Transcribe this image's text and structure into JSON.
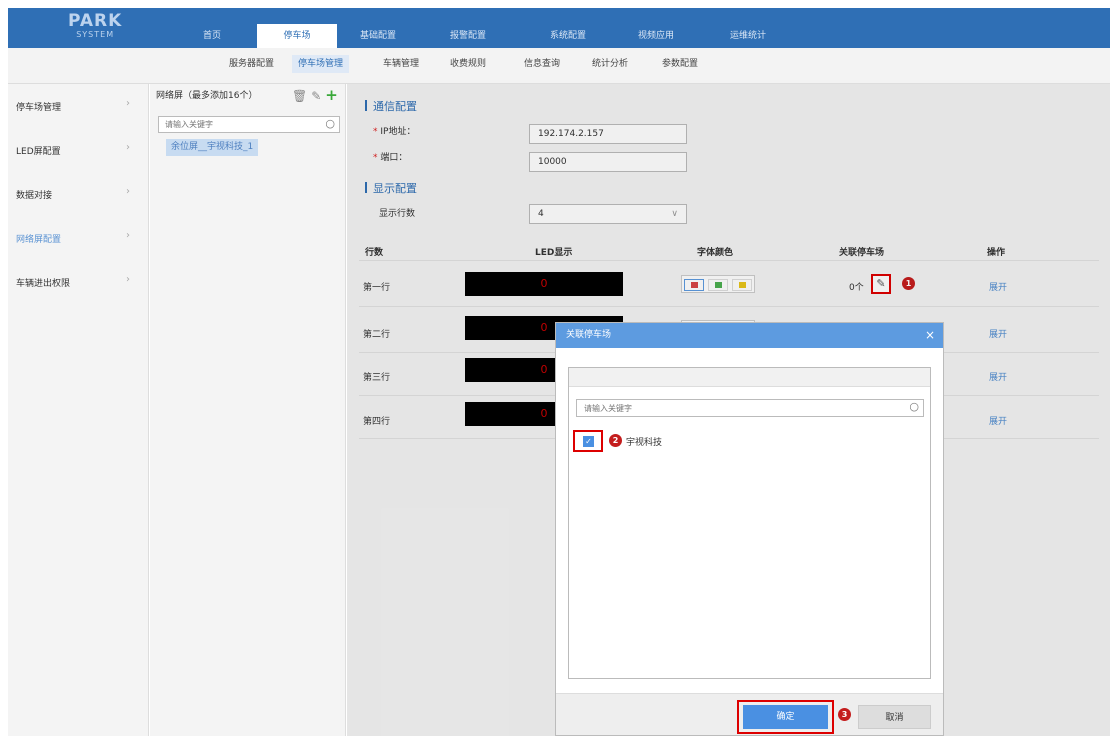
{
  "logo": {
    "line1": "PARK",
    "line2": "SYSTEM"
  },
  "nav": {
    "tabs": [
      "首页",
      "停车场",
      "基础配置",
      "报警配置",
      "系统配置",
      "视频应用",
      "运维统计"
    ],
    "active": "停车场"
  },
  "subnav": {
    "items": [
      "服务器配置",
      "停车场管理",
      "车辆管理",
      "收费规则",
      "信息查询",
      "统计分析",
      "参数配置"
    ],
    "active": "停车场管理"
  },
  "sidebar": {
    "items": [
      "停车场管理",
      "LED屏配置",
      "数据对接",
      "网络屏配置",
      "车辆进出权限"
    ],
    "active": "网络屏配置"
  },
  "list_panel": {
    "header": "网络屏（最多添加16个）",
    "search_placeholder": "请输入关键字",
    "selected_item": "余位屏__宇视科技_1"
  },
  "comm_config": {
    "title": "通信配置",
    "ip_label": "IP地址：",
    "ip_value": "192.174.2.157",
    "port_label": "端口：",
    "port_value": "10000"
  },
  "display_config": {
    "title": "显示配置",
    "rows_label": "显示行数",
    "rows_value": "4"
  },
  "table": {
    "headers": [
      "行数",
      "LED显示",
      "字体颜色",
      "关联停车场",
      "操作"
    ],
    "rows": [
      {
        "label": "第一行",
        "led": "0",
        "link_count": "0个",
        "action": "展开"
      },
      {
        "label": "第二行",
        "led": "0",
        "action": "展开"
      },
      {
        "label": "第三行",
        "led": "0",
        "action": "展开"
      },
      {
        "label": "第四行",
        "led": "0",
        "action": "展开"
      }
    ]
  },
  "colors": {
    "red": "#d84545",
    "green": "#4caf50",
    "yellow": "#e8c51a",
    "accent": "#2f6fb5"
  },
  "callouts": [
    "1",
    "2",
    "3"
  ],
  "dialog": {
    "title": "关联停车场",
    "search_placeholder": "请输入关键字",
    "option_label": "宇视科技",
    "option_checked": true,
    "ok_label": "确定",
    "cancel_label": "取消"
  }
}
